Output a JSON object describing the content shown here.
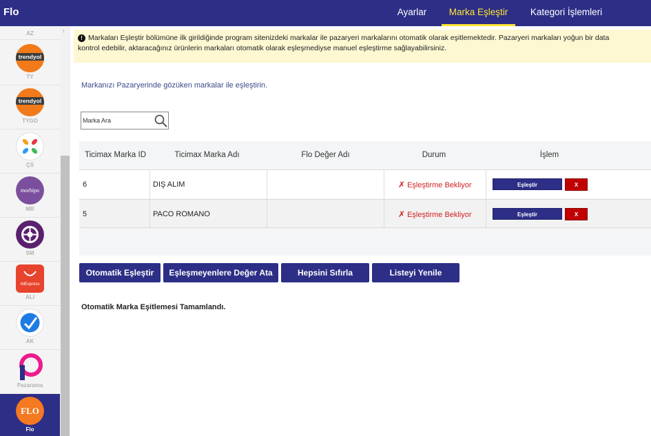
{
  "app": {
    "title": "Flo"
  },
  "nav": {
    "items": [
      {
        "label": "Ayarlar"
      },
      {
        "label": "Marka Eşleştir",
        "active": true
      },
      {
        "label": "Kategori İşlemleri"
      }
    ]
  },
  "sidebar": {
    "top_code": "AZ",
    "items": [
      {
        "code": "TY",
        "logo_text": "trendyol",
        "icon": "trendyol-logo-icon"
      },
      {
        "code": "TYGO",
        "logo_text": "trendyol",
        "icon": "trendyol-go-logo-icon"
      },
      {
        "code": "ÇS",
        "icon": "ciceksepeti-logo-icon"
      },
      {
        "code": "MR",
        "logo_text": "morhipo",
        "icon": "morhipo-logo-icon"
      },
      {
        "code": "SM",
        "icon": "shopiconmall-logo-icon"
      },
      {
        "code": "ALI",
        "logo_text": "AliExpress",
        "icon": "aliexpress-logo-icon"
      },
      {
        "code": "AK",
        "icon": "akakce-logo-icon"
      },
      {
        "code": "Pazarama",
        "icon": "pazarama-logo-icon"
      },
      {
        "code": "Flo",
        "logo_text": "FLO",
        "icon": "flo-logo-icon",
        "active": true
      }
    ]
  },
  "notice": {
    "line1": "Markaları Eşleştir bölümüne ilk girildiğinde program sitenizdeki markalar ile pazaryeri markalarını otomatik olarak eşitlemektedir. Pazaryeri markaları yoğun bir data",
    "line2": "kontrol edebilir, aktaracağınız ürünlerin markaları otomatik olarak eşleşmediyse manuel eşleştirme sağlayabilirsiniz."
  },
  "instruction": "Markanızı Pazaryerinde gözüken markalar ile eşleştirin.",
  "search": {
    "placeholder": "Marka Ara"
  },
  "table": {
    "headers": {
      "id": "Ticimax Marka ID",
      "name": "Ticimax Marka Adı",
      "flo_value": "Flo Değer Adı",
      "status": "Durum",
      "action": "İşlem"
    },
    "rows": [
      {
        "id": "6",
        "name": "DIŞ ALIM",
        "flo_value": "",
        "status": "Eşleştirme Bekliyor",
        "match_label": "Eşleştir",
        "delete_label": "X"
      },
      {
        "id": "5",
        "name": "PACO ROMANO",
        "flo_value": "",
        "status": "Eşleştirme Bekliyor",
        "match_label": "Eşleştir",
        "delete_label": "X"
      }
    ]
  },
  "actions": {
    "auto_match": "Otomatik Eşleştir",
    "assign_unmatched": "Eşleşmeyenlere Değer Ata",
    "reset_all": "Hepsini Sıfırla",
    "refresh_list": "Listeyi Yenile"
  },
  "result_message": "Otomatik Marka Eşitlemesi Tamamlandı.",
  "colors": {
    "primary": "#2d2e86",
    "active_nav": "#ffe633",
    "notice_bg": "#fdf7d2",
    "status_pending": "#d41f1f",
    "delete": "#c00000"
  }
}
